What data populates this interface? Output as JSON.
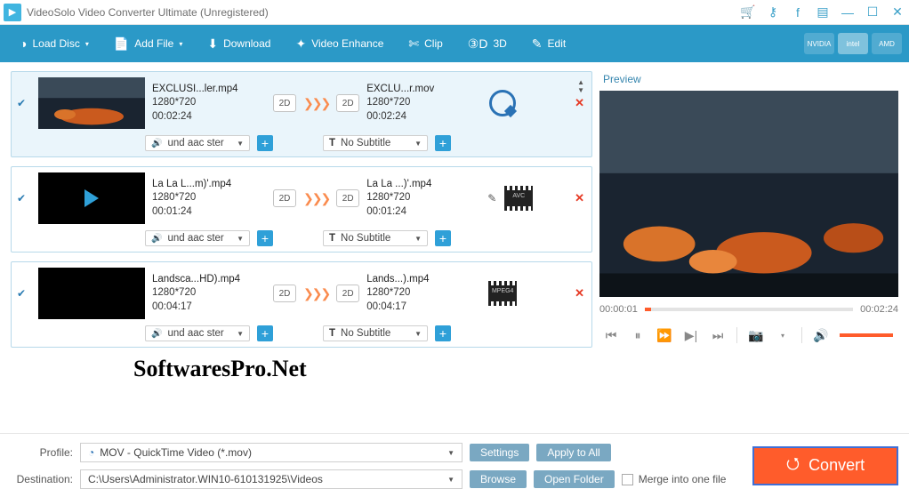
{
  "title": "VideoSolo Video Converter Ultimate (Unregistered)",
  "toolbar": {
    "load": "Load Disc",
    "add": "Add File",
    "download": "Download",
    "enhance": "Video Enhance",
    "clip": "Clip",
    "threed": "3D",
    "edit": "Edit"
  },
  "gpu": [
    "NVIDIA",
    "intel",
    "AMD"
  ],
  "preview": {
    "title": "Preview",
    "current": "00:00:01",
    "total": "00:02:24"
  },
  "items": [
    {
      "src_name": "EXCLUSI...ler.mp4",
      "src_res": "1280*720",
      "src_dur": "00:02:24",
      "dst_name": "EXCLU...r.mov",
      "dst_res": "1280*720",
      "dst_dur": "00:02:24",
      "audio": "und aac ster",
      "subtitle": "No Subtitle",
      "fmt": "qt",
      "thumb": "fire",
      "selected": true
    },
    {
      "src_name": "La La L...m)'.mp4",
      "src_res": "1280*720",
      "src_dur": "00:01:24",
      "dst_name": "La La ...)'.mp4",
      "dst_res": "1280*720",
      "dst_dur": "00:01:24",
      "audio": "und aac ster",
      "subtitle": "No Subtitle",
      "fmt": "avc",
      "thumb": "play",
      "selected": false
    },
    {
      "src_name": "Landsca...HD).mp4",
      "src_res": "1280*720",
      "src_dur": "00:04:17",
      "dst_name": "Lands...).mp4",
      "dst_res": "1280*720",
      "dst_dur": "00:04:17",
      "audio": "und aac ster",
      "subtitle": "No Subtitle",
      "fmt": "mpeg4",
      "thumb": "black",
      "selected": false
    }
  ],
  "twod": "2D",
  "subprefix": "T",
  "bottom": {
    "profile_label": "Profile:",
    "profile_value": "MOV - QuickTime Video (*.mov)",
    "dest_label": "Destination:",
    "dest_value": "C:\\Users\\Administrator.WIN10-610131925\\Videos",
    "settings": "Settings",
    "applyall": "Apply to All",
    "browse": "Browse",
    "openfolder": "Open Folder",
    "merge": "Merge into one file",
    "convert": "Convert"
  },
  "watermark": "SoftwaresPro.Net"
}
